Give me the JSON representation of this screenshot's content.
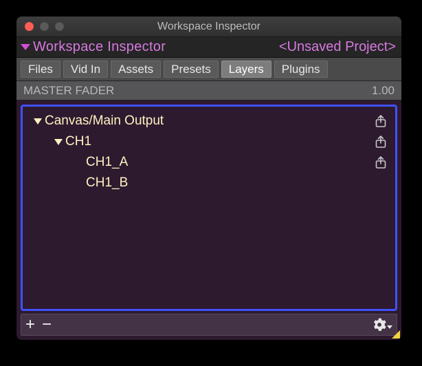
{
  "window": {
    "title": "Workspace Inspector"
  },
  "header": {
    "title": "Workspace Inspector",
    "project_label": "<Unsaved Project>"
  },
  "tabs": [
    {
      "label": "Files",
      "active": false
    },
    {
      "label": "Vid In",
      "active": false
    },
    {
      "label": "Assets",
      "active": false
    },
    {
      "label": "Presets",
      "active": false
    },
    {
      "label": "Layers",
      "active": true
    },
    {
      "label": "Plugins",
      "active": false
    }
  ],
  "fader": {
    "label": "MASTER FADER",
    "value": "1.00"
  },
  "tree": [
    {
      "label": "Canvas/Main Output",
      "depth": 0,
      "expanded": true,
      "share": true
    },
    {
      "label": "CH1",
      "depth": 1,
      "expanded": true,
      "share": true
    },
    {
      "label": "CH1_A",
      "depth": 2,
      "expanded": false,
      "share": true
    },
    {
      "label": "CH1_B",
      "depth": 2,
      "expanded": false,
      "share": false
    }
  ],
  "toolbar": {
    "add_label": "+",
    "remove_label": "−"
  }
}
